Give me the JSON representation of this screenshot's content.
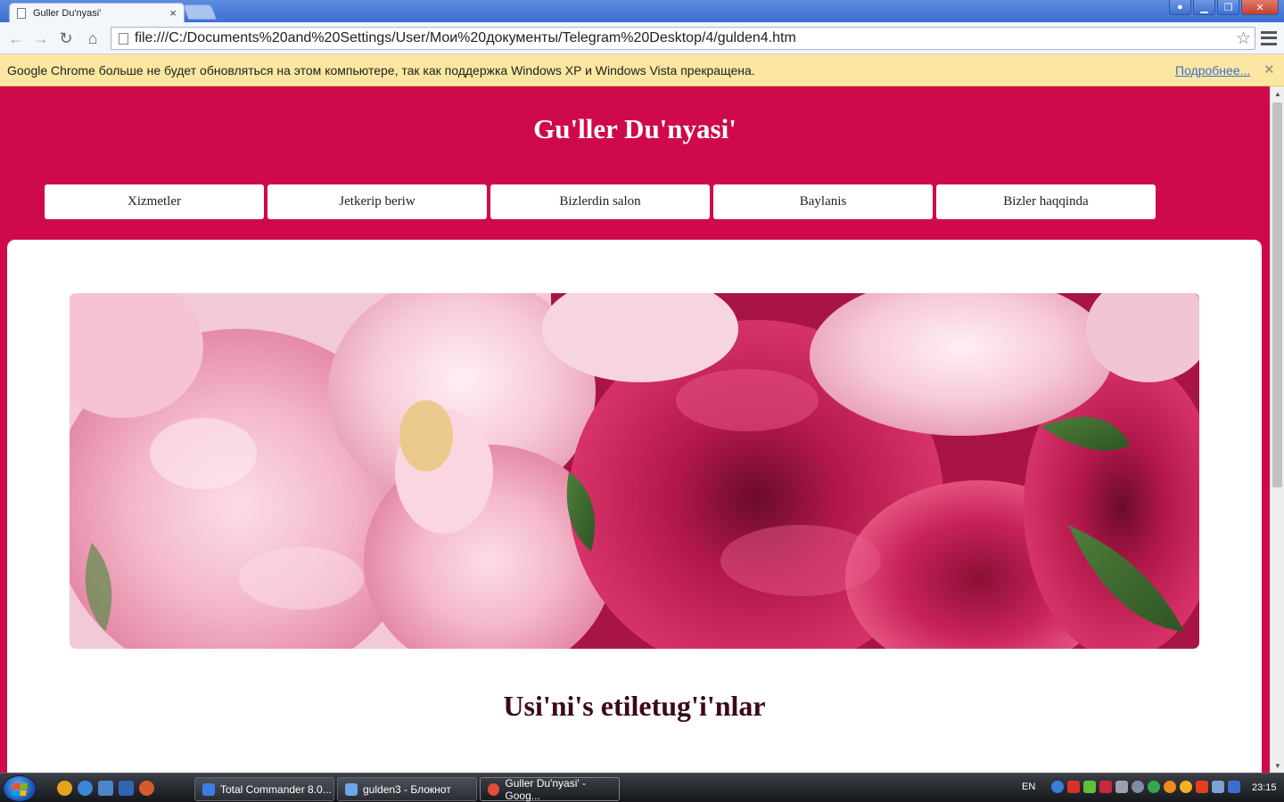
{
  "browser": {
    "tab_title": "Guller Du'nyasi'",
    "address": "file:///C:/Documents%20and%20Settings/User/Мои%20документы/Telegram%20Desktop/4/gulden4.htm",
    "infobar_message": "Google Chrome больше не будет обновляться на этом компьютере, так как поддержка Windows XP и Windows Vista прекращена.",
    "infobar_link": "Подробнее..."
  },
  "site": {
    "title": "Gu'ller Du'nyasi'",
    "nav": [
      "Xizmetler",
      "Jetkerip beriw",
      "Bizlerdin salon",
      "Baylanis",
      "Bizler haqqinda"
    ],
    "section_title": "Usi'ni's etiletug'i'nlar",
    "hero_image": "pink and red peony flowers"
  },
  "taskbar": {
    "tasks": [
      {
        "label": "Total Commander 8.0...",
        "icon": "total-commander-icon",
        "color": "#3d7ee6"
      },
      {
        "label": "gulden3 - Блокнот",
        "icon": "notepad-icon",
        "color": "#6ea5e8"
      },
      {
        "label": "Guller Du'nyasi' - Goog...",
        "icon": "chrome-icon",
        "color": "#e34b3a"
      }
    ],
    "lang": "EN",
    "clock": "23:15"
  },
  "colors": {
    "brand": "#cf0a4a",
    "section_title": "#3a0a18"
  }
}
